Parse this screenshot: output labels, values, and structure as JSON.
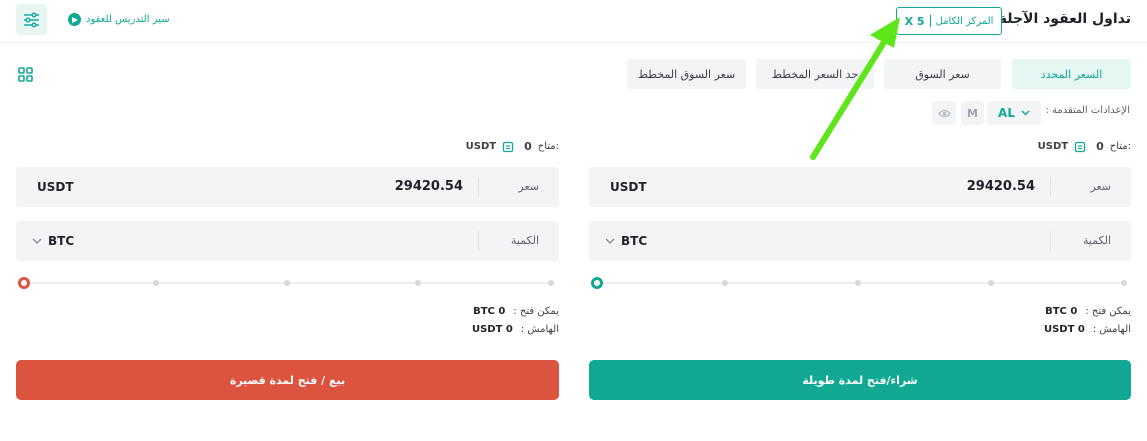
{
  "header": {
    "title": "تداول العقود الآجلة",
    "margin_mode": "المركز الكامل",
    "leverage": "X 5",
    "tutorial": "سير التدريس للعقود"
  },
  "order_types": [
    {
      "label": "السعر المحدد",
      "active": true
    },
    {
      "label": "سعر السوق",
      "active": false
    },
    {
      "label": "حد السعر المخطط",
      "active": false
    },
    {
      "label": "سعر السوق المخطط",
      "active": false
    }
  ],
  "advanced": {
    "label": "الإعدادات المتقدمة :",
    "al": "AL",
    "m": "M"
  },
  "long_panel": {
    "available_label": "متاح:",
    "available_value": "0",
    "available_currency": "USDT",
    "price_label": "سعر",
    "price_value": "29420.54",
    "price_unit": "USDT",
    "qty_label": "الكمية",
    "qty_unit": "BTC",
    "slider_percent": 0,
    "can_open_label": "يمكن فتح :",
    "can_open_value": "BTC 0",
    "margin_label": "الهامش :",
    "margin_value": "USDT 0",
    "button": "شراء/فتح لمدة طويلة"
  },
  "short_panel": {
    "available_label": "متاح:",
    "available_value": "0",
    "available_currency": "USDT",
    "price_label": "سعر",
    "price_value": "29420.54",
    "price_unit": "USDT",
    "qty_label": "الكمية",
    "qty_unit": "BTC",
    "slider_percent": 0,
    "can_open_label": "يمكن فتح :",
    "can_open_value": "BTC 0",
    "margin_label": "الهامش :",
    "margin_value": "USDT 0",
    "button": "بيع / فتح لمدة قصيرة"
  },
  "colors": {
    "accent": "#11a993",
    "sell": "#dc5340",
    "annotation_arrow": "#5ee61a"
  },
  "icons": [
    "settings-sliders-icon",
    "play-icon",
    "grid-layout-icon",
    "eye-icon",
    "chevron-down-icon",
    "transfer-icon"
  ]
}
